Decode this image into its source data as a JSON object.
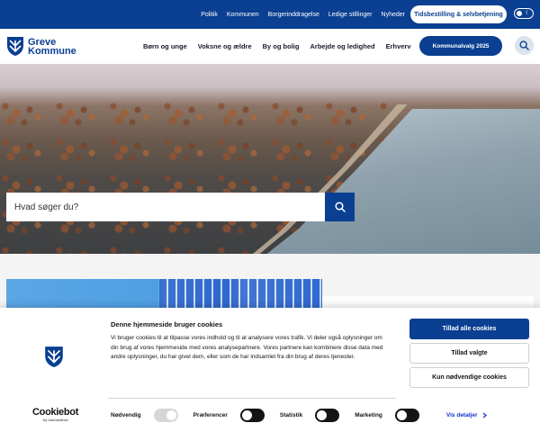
{
  "topbar": {
    "links": [
      "Politik",
      "Kommunen",
      "Borgerinddragelse",
      "Ledige stillinger",
      "Nyheder"
    ],
    "pill_label": "Tidsbestilling & selvbetjening",
    "toggle_icon": "moon-icon"
  },
  "header": {
    "logo_line1": "Greve",
    "logo_line2": "Kommune",
    "nav": [
      "Børn og unge",
      "Voksne og ældre",
      "By og bolig",
      "Arbejde og ledighed",
      "Erhverv"
    ],
    "cta_label": "Kommunalvalg 2025",
    "search_icon": "search-icon"
  },
  "hero": {
    "search_placeholder": "Hvad søger du?",
    "search_value": ""
  },
  "cookie": {
    "title": "Denne hjemmeside bruger cookies",
    "body": "Vi bruger cookies til at tilpasse vores indhold og til at analysere vores trafik. Vi deler også oplysninger om din brug af vores hjemmeside med vores analysepartnere. Vores partnere kan kombinere disse data med andre oplysninger, du har givet dem, eller som de har indsamlet fra din brug af deres tjenester.",
    "buttons": {
      "allow_all": "Tillad alle cookies",
      "allow_selected": "Tillad valgte",
      "necessary_only": "Kun nødvendige cookies"
    },
    "brand": "Cookiebot",
    "brand_sub": "by Usercentrics",
    "toggles": [
      {
        "label": "Nødvendig",
        "on": true,
        "disabled": true
      },
      {
        "label": "Præferencer",
        "on": false,
        "disabled": false
      },
      {
        "label": "Statistik",
        "on": false,
        "disabled": false
      },
      {
        "label": "Marketing",
        "on": false,
        "disabled": false
      }
    ],
    "details_label": "Vis detaljer"
  },
  "colors": {
    "brand_blue": "#0a3f91",
    "link_blue": "#1032cf",
    "toggle_dark": "#141414"
  }
}
